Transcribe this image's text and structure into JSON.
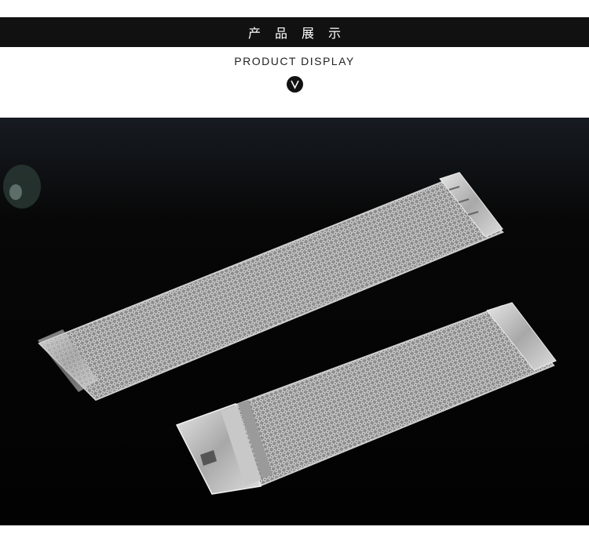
{
  "header": {
    "title_cn": "产品展示",
    "subtitle": "PRODUCT DISPLAY",
    "banner_color": "#111111"
  },
  "badge": {
    "icon": "chevron-down-icon"
  },
  "photo": {
    "subject": "mesh-watch-strap-pair",
    "background_color": "#050505",
    "metal_color": "#b9b9b9"
  }
}
